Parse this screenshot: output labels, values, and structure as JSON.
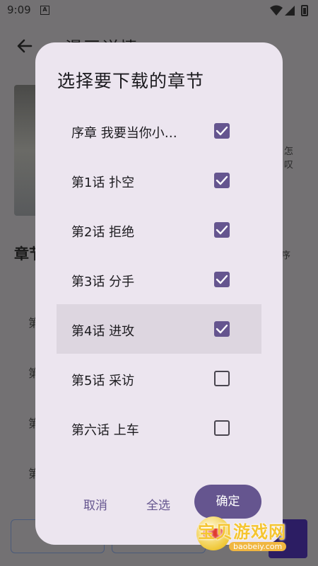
{
  "status_bar": {
    "time": "9:09",
    "notification_icon": "A",
    "icons": [
      "notification-a-icon",
      "wifi-icon",
      "signal-icon",
      "battery-icon"
    ]
  },
  "background_page": {
    "back_icon": "arrow-left-icon",
    "title": "漫画详情",
    "desc_line1": "怎",
    "desc_line2": "叹",
    "section_label": "章节",
    "sort_label": "序",
    "chapter_stubs": [
      "第",
      "第",
      "第",
      "第"
    ]
  },
  "dialog": {
    "title": "选择要下载的章节",
    "chapters": [
      {
        "label": "序章 我要当你小…",
        "checked": true,
        "highlighted": false
      },
      {
        "label": "第1话 扑空",
        "checked": true,
        "highlighted": false
      },
      {
        "label": "第2话 拒绝",
        "checked": true,
        "highlighted": false
      },
      {
        "label": "第3话 分手",
        "checked": true,
        "highlighted": false
      },
      {
        "label": "第4话 进攻",
        "checked": true,
        "highlighted": true
      },
      {
        "label": "第5话 采访",
        "checked": false,
        "highlighted": false
      },
      {
        "label": "第六话 上车",
        "checked": false,
        "highlighted": false
      }
    ],
    "actions": {
      "cancel": "取消",
      "select_all": "全选",
      "confirm": "确定"
    }
  },
  "watermark": {
    "text": "宝贝游戏网",
    "url": "baobeiy.com"
  },
  "colors": {
    "accent": "#65558f",
    "dialog_bg": "#ece5ef",
    "scrim": "#737173"
  }
}
